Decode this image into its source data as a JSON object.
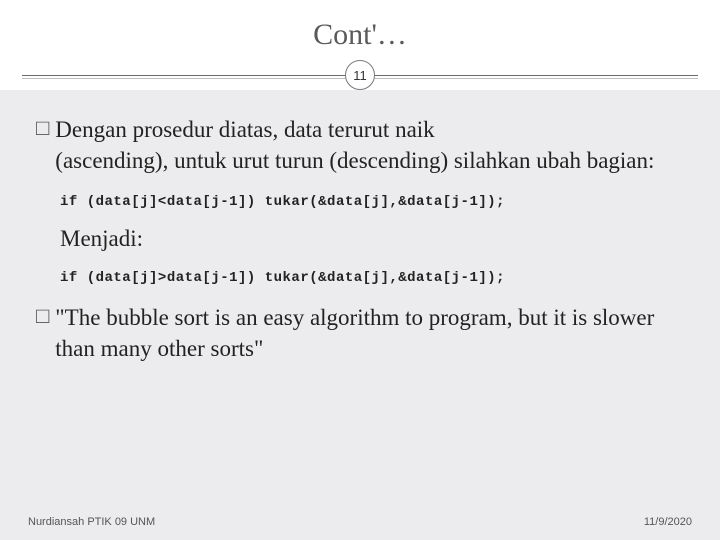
{
  "header": {
    "title": "Cont'…",
    "slide_number": "11"
  },
  "content": {
    "bullet1_lead": "Dengan prosedur diatas,  data terurut naik",
    "bullet1_cont": "(ascending),  untuk  urut turun (descending) silahkan ubah bagian:",
    "code1": "if (data[j]<data[j-1]) tukar(&data[j],&data[j-1]);",
    "menjadi": "Menjadi:",
    "code2": "if (data[j]>data[j-1]) tukar(&data[j],&data[j-1]);",
    "quote": "\"The bubble sort is an easy algorithm to program, but it is slower than many other sorts\""
  },
  "footer": {
    "author": "Nurdiansah PTIK 09 UNM",
    "date": "11/9/2020"
  },
  "glyphs": {
    "square": "□"
  }
}
